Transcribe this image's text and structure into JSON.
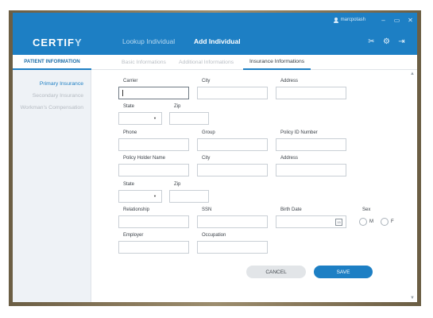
{
  "window": {
    "user": "marcpotash",
    "controls": {
      "minimize": "–",
      "maximize": "▭",
      "close": "✕"
    }
  },
  "header": {
    "logo_main": "CERTIF",
    "logo_tail": "Y",
    "nav": {
      "lookup": "Lookup Individual",
      "add": "Add Individual"
    },
    "icons": [
      "tools-icon",
      "gear-icon",
      "logout-icon"
    ]
  },
  "subbar": {
    "section": "PATIENT INFORMATION",
    "tabs": {
      "basic": "Basic Informations",
      "additional": "Additional Informations",
      "insurance": "Insurance Informations"
    },
    "active_tab": "Insurance Informations"
  },
  "sidebar": {
    "primary": "Primary Insurance",
    "secondary": "Secondary Insurance",
    "workman": "Workman's Compensation"
  },
  "form": {
    "labels": {
      "carrier": "Carrier",
      "city1": "City",
      "address1": "Address",
      "state1": "State",
      "zip1": "Zip",
      "phone": "Phone",
      "group": "Group",
      "policy_id": "Policy ID Number",
      "holder_name": "Policy Holder Name",
      "city2": "City",
      "address2": "Address",
      "state2": "State",
      "zip2": "Zip",
      "relationship": "Relationship",
      "ssn": "SSN",
      "birth_date": "Birth Date",
      "sex": "Sex",
      "employer": "Employer",
      "occupation": "Occupation"
    },
    "sex_options": {
      "male": "M",
      "female": "F"
    },
    "calendar_glyph": "15"
  },
  "actions": {
    "cancel": "CANCEL",
    "save": "SAVE"
  },
  "colors": {
    "brand": "#1d7fc4",
    "frame": "#8a7a5c",
    "cancel_bg": "#e2e5e8"
  }
}
